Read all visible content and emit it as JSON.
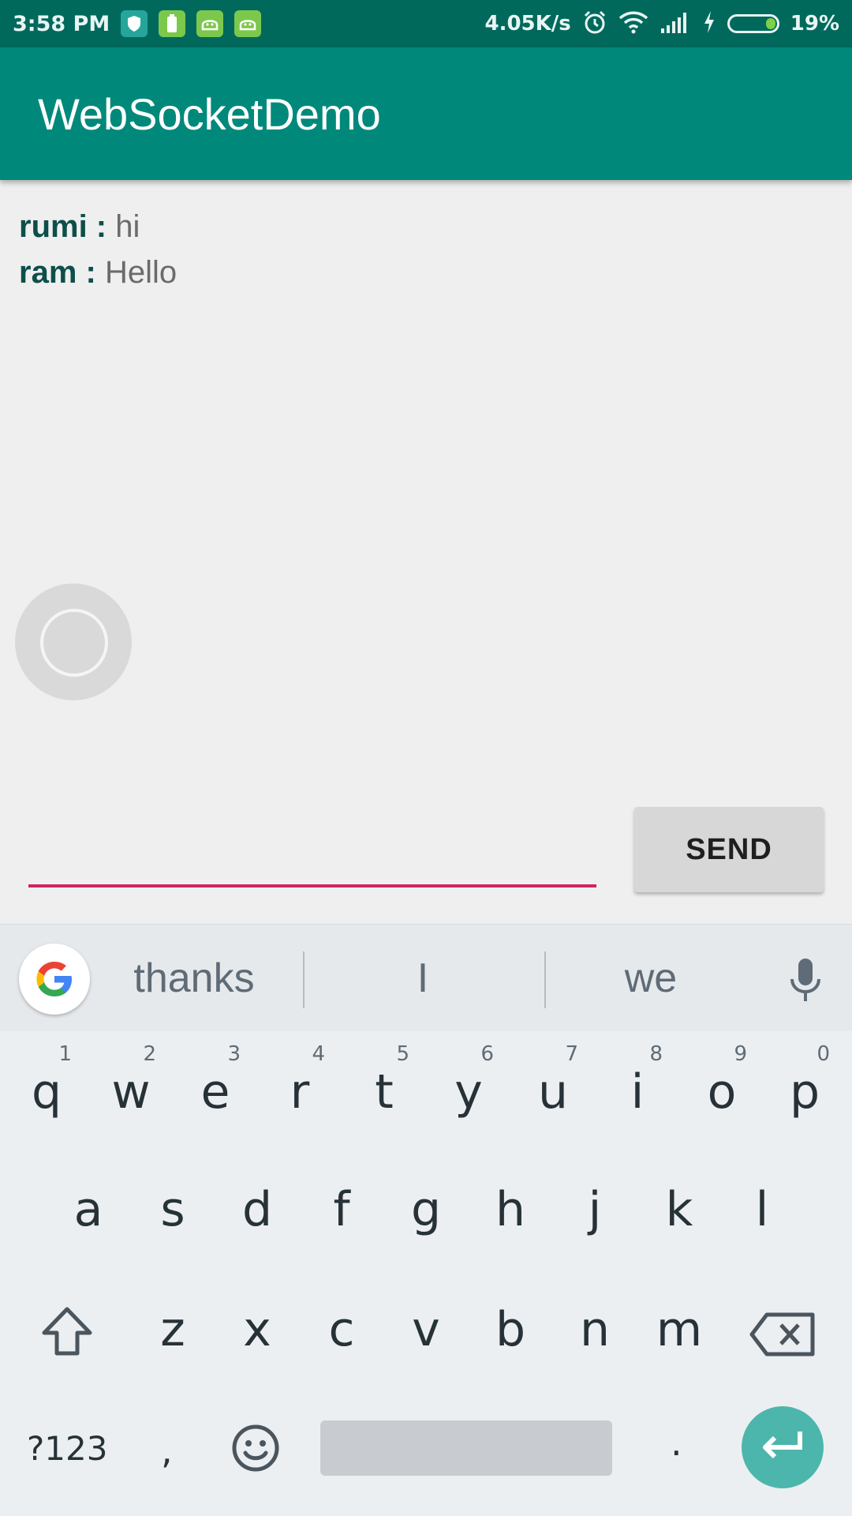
{
  "status_bar": {
    "time": "3:58 PM",
    "net_speed": "4.05K/s",
    "battery_pct": "19%",
    "icons": [
      "shield-icon",
      "battery-app-icon",
      "android-icon",
      "android-icon",
      "alarm-icon",
      "wifi-icon",
      "signal-icon",
      "charging-icon",
      "battery-icon"
    ]
  },
  "app_bar": {
    "title": "WebSocketDemo"
  },
  "messages": [
    {
      "user": "rumi :",
      "text": "hi"
    },
    {
      "user": "ram :",
      "text": "Hello"
    }
  ],
  "compose": {
    "input_value": "",
    "send_label": "SEND"
  },
  "keyboard": {
    "suggestions": [
      "thanks",
      "I",
      "we"
    ],
    "row1": [
      {
        "key": "q",
        "hint": "1"
      },
      {
        "key": "w",
        "hint": "2"
      },
      {
        "key": "e",
        "hint": "3"
      },
      {
        "key": "r",
        "hint": "4"
      },
      {
        "key": "t",
        "hint": "5"
      },
      {
        "key": "y",
        "hint": "6"
      },
      {
        "key": "u",
        "hint": "7"
      },
      {
        "key": "i",
        "hint": "8"
      },
      {
        "key": "o",
        "hint": "9"
      },
      {
        "key": "p",
        "hint": "0"
      }
    ],
    "row2": [
      "a",
      "s",
      "d",
      "f",
      "g",
      "h",
      "j",
      "k",
      "l"
    ],
    "row3": [
      "z",
      "x",
      "c",
      "v",
      "b",
      "n",
      "m"
    ],
    "symbols_label": "?123",
    "comma": ",",
    "period": "."
  },
  "colors": {
    "status_bar": "#00695c",
    "app_bar": "#00897b",
    "accent": "#cf2260",
    "enter_key": "#4db6ac"
  }
}
